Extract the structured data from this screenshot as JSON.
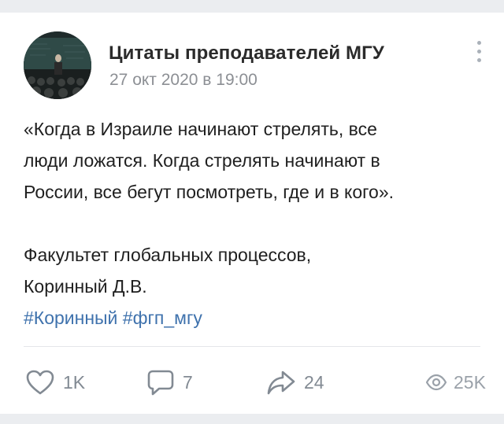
{
  "post": {
    "author": "Цитаты преподавателей МГУ",
    "date": "27 окт 2020 в 19:00",
    "text_lines": [
      "«Когда в Израиле начинают стрелять, все",
      "люди ложатся. Когда стрелять начинают в",
      "России, все бегут посмотреть, где и в кого»."
    ],
    "attribution_lines": [
      "Факультет глобальных процессов,",
      "Коринный Д.В."
    ],
    "tags": [
      "#Коринный",
      "#фгп_мгу"
    ]
  },
  "actions": {
    "likes": "1K",
    "comments": "7",
    "shares": "24",
    "views": "25K"
  },
  "colors": {
    "link": "#3f72ad",
    "icon": "#828a93",
    "muted": "#8c8f94"
  },
  "icons": {
    "like": "heart-icon",
    "comment": "comment-bubble-icon",
    "share": "share-arrow-icon",
    "views": "eye-icon",
    "more": "vertical-dots-icon"
  }
}
